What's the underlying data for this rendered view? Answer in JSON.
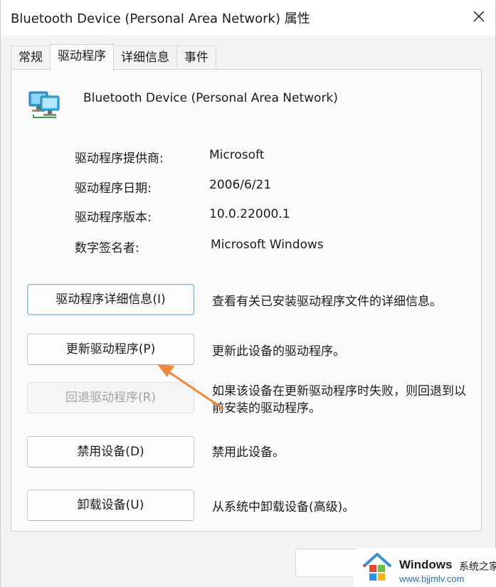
{
  "window": {
    "title": "Bluetooth Device (Personal Area Network) 属性"
  },
  "tabs": [
    {
      "label": "常规",
      "active": false
    },
    {
      "label": "驱动程序",
      "active": true
    },
    {
      "label": "详细信息",
      "active": false
    },
    {
      "label": "事件",
      "active": false
    }
  ],
  "device": {
    "name": "Bluetooth Device (Personal Area Network)",
    "icon": "network-adapter-icon"
  },
  "driver_info": [
    {
      "label": "驱动程序提供商:",
      "value": "Microsoft"
    },
    {
      "label": "驱动程序日期:",
      "value": "2006/6/21"
    },
    {
      "label": "驱动程序版本:",
      "value": "10.0.22000.1"
    },
    {
      "label": "数字签名者:",
      "value": "Microsoft Windows"
    }
  ],
  "actions": [
    {
      "button": "驱动程序详细信息(I)",
      "description": "查看有关已安装驱动程序文件的详细信息。",
      "enabled": true
    },
    {
      "button": "更新驱动程序(P)",
      "description": "更新此设备的驱动程序。",
      "enabled": true
    },
    {
      "button": "回退驱动程序(R)",
      "description": "如果该设备在更新驱动程序时失败，则回退到以前安装的驱动程序。",
      "enabled": false
    },
    {
      "button": "禁用设备(D)",
      "description": "禁用此设备。",
      "enabled": true
    },
    {
      "button": "卸载设备(U)",
      "description": "从系统中卸载设备(高级)。",
      "enabled": true
    }
  ],
  "watermark": {
    "brand": "Windows",
    "sub": "系统之家",
    "url": "www.bjjmlv.com"
  },
  "colors": {
    "arrow": "#f0883a",
    "focus_border": "#8cb3d9",
    "watermark_url": "#2a6fbf"
  }
}
